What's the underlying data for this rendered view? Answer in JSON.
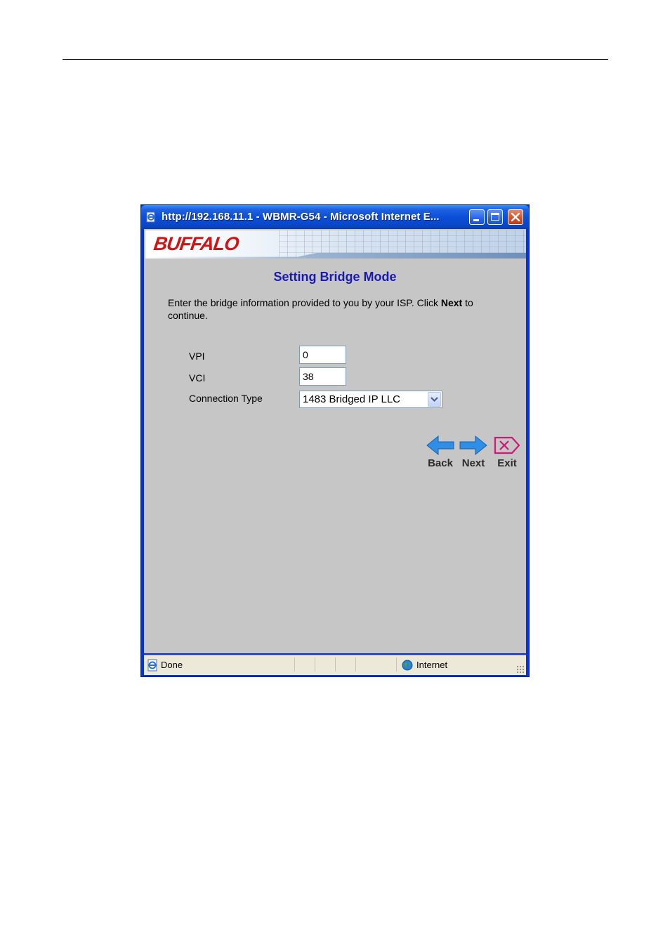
{
  "window": {
    "title": "http://192.168.11.1 - WBMR-G54 - Microsoft Internet E..."
  },
  "banner": {
    "logo": "BUFFALO"
  },
  "page": {
    "title": "Setting Bridge Mode",
    "instruction_pre": "Enter the bridge information provided to you by your ISP. Click ",
    "instruction_bold": "Next",
    "instruction_post": " to continue."
  },
  "form": {
    "vpi_label": "VPI",
    "vpi_value": "0",
    "vci_label": "VCI",
    "vci_value": "38",
    "connection_type_label": "Connection Type",
    "connection_type_value": "1483 Bridged IP LLC"
  },
  "nav": {
    "back_label": "Back",
    "next_label": "Next",
    "exit_label": "Exit"
  },
  "status": {
    "text": "Done",
    "zone": "Internet"
  },
  "colors": {
    "title_blue": "#1a1ab0",
    "arrow_blue": "#2f8ee6",
    "exit_magenta": "#d0187a",
    "logo_red": "#d01414"
  }
}
